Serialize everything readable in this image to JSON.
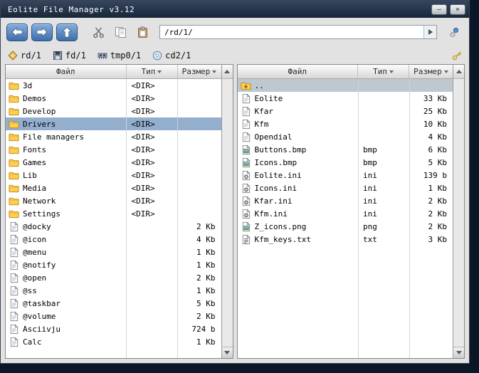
{
  "window": {
    "title": "Eolite File Manager v3.12",
    "minimize_glyph": "—",
    "close_glyph": "×"
  },
  "toolbar": {
    "path_value": "/rd/1/"
  },
  "device_bar": {
    "devices": [
      {
        "label": "rd/1"
      },
      {
        "label": "fd/1"
      },
      {
        "label": "tmp0/1"
      },
      {
        "label": "cd2/1"
      }
    ]
  },
  "columns": {
    "file": "Файл",
    "type": "Тип",
    "size": "Размер"
  },
  "left_panel": {
    "rows": [
      {
        "name": "3d",
        "type": "<DIR>",
        "size": "",
        "icon": "folder"
      },
      {
        "name": "Demos",
        "type": "<DIR>",
        "size": "",
        "icon": "folder"
      },
      {
        "name": "Develop",
        "type": "<DIR>",
        "size": "",
        "icon": "folder"
      },
      {
        "name": "Drivers",
        "type": "<DIR>",
        "size": "",
        "icon": "folder",
        "state": "selected"
      },
      {
        "name": "File managers",
        "type": "<DIR>",
        "size": "",
        "icon": "folder"
      },
      {
        "name": "Fonts",
        "type": "<DIR>",
        "size": "",
        "icon": "folder"
      },
      {
        "name": "Games",
        "type": "<DIR>",
        "size": "",
        "icon": "folder"
      },
      {
        "name": "Lib",
        "type": "<DIR>",
        "size": "",
        "icon": "folder"
      },
      {
        "name": "Media",
        "type": "<DIR>",
        "size": "",
        "icon": "folder"
      },
      {
        "name": "Network",
        "type": "<DIR>",
        "size": "",
        "icon": "folder"
      },
      {
        "name": "Settings",
        "type": "<DIR>",
        "size": "",
        "icon": "folder"
      },
      {
        "name": "@docky",
        "type": "",
        "size": "2 Kb",
        "icon": "file"
      },
      {
        "name": "@icon",
        "type": "",
        "size": "4 Kb",
        "icon": "file"
      },
      {
        "name": "@menu",
        "type": "",
        "size": "1 Kb",
        "icon": "file"
      },
      {
        "name": "@notify",
        "type": "",
        "size": "1 Kb",
        "icon": "file"
      },
      {
        "name": "@open",
        "type": "",
        "size": "2 Kb",
        "icon": "file"
      },
      {
        "name": "@ss",
        "type": "",
        "size": "1 Kb",
        "icon": "file"
      },
      {
        "name": "@taskbar",
        "type": "",
        "size": "5 Kb",
        "icon": "file"
      },
      {
        "name": "@volume",
        "type": "",
        "size": "2 Kb",
        "icon": "file"
      },
      {
        "name": "Asciivju",
        "type": "",
        "size": "724 b",
        "icon": "file"
      },
      {
        "name": "Calc",
        "type": "",
        "size": "1 Kb",
        "icon": "file"
      }
    ]
  },
  "right_panel": {
    "rows": [
      {
        "name": "..",
        "type": "",
        "size": "",
        "icon": "folder-up",
        "state": "cursor"
      },
      {
        "name": "Eolite",
        "type": "",
        "size": "33 Kb",
        "icon": "file"
      },
      {
        "name": "Kfar",
        "type": "",
        "size": "25 Kb",
        "icon": "file"
      },
      {
        "name": "Kfm",
        "type": "",
        "size": "10 Kb",
        "icon": "file"
      },
      {
        "name": "Opendial",
        "type": "",
        "size": "4 Kb",
        "icon": "file"
      },
      {
        "name": "Buttons.bmp",
        "type": "bmp",
        "size": "6 Kb",
        "icon": "image"
      },
      {
        "name": "Icons.bmp",
        "type": "bmp",
        "size": "5 Kb",
        "icon": "image"
      },
      {
        "name": "Eolite.ini",
        "type": "ini",
        "size": "139 b",
        "icon": "ini"
      },
      {
        "name": "Icons.ini",
        "type": "ini",
        "size": "1 Kb",
        "icon": "ini"
      },
      {
        "name": "Kfar.ini",
        "type": "ini",
        "size": "2 Kb",
        "icon": "ini"
      },
      {
        "name": "Kfm.ini",
        "type": "ini",
        "size": "2 Kb",
        "icon": "ini"
      },
      {
        "name": "Z_icons.png",
        "type": "png",
        "size": "2 Kb",
        "icon": "image"
      },
      {
        "name": "Kfm_keys.txt",
        "type": "txt",
        "size": "3 Kb",
        "icon": "txt"
      }
    ]
  }
}
